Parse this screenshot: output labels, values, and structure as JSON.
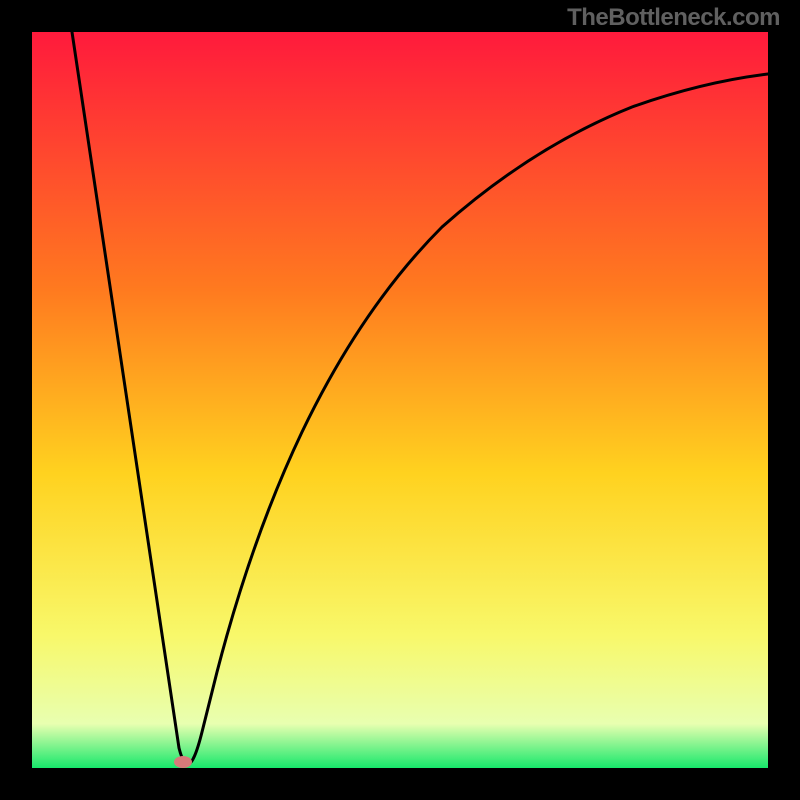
{
  "watermark": "TheBottleneck.com",
  "chart_data": {
    "type": "line",
    "title": "",
    "xlabel": "",
    "ylabel": "",
    "xlim": [
      0,
      100
    ],
    "ylim": [
      0,
      100
    ],
    "series": [
      {
        "name": "bottleneck-curve",
        "x": [
          1,
          5,
          10,
          15,
          18,
          20,
          20.5,
          21,
          22,
          24,
          28,
          34,
          42,
          50,
          60,
          70,
          80,
          90,
          100
        ],
        "values": [
          100,
          80,
          55,
          30,
          15,
          5,
          1,
          2,
          8,
          20,
          38,
          55,
          70,
          78,
          85,
          89,
          91,
          93,
          94
        ]
      }
    ],
    "marker": {
      "x": 20.5,
      "y": 1
    },
    "gradient_stops": [
      {
        "offset": 0.0,
        "color": "#ff1a3c"
      },
      {
        "offset": 0.35,
        "color": "#ff7a1f"
      },
      {
        "offset": 0.6,
        "color": "#ffd21f"
      },
      {
        "offset": 0.82,
        "color": "#f8f86a"
      },
      {
        "offset": 0.94,
        "color": "#e8ffb0"
      },
      {
        "offset": 1.0,
        "color": "#17e86b"
      }
    ]
  }
}
